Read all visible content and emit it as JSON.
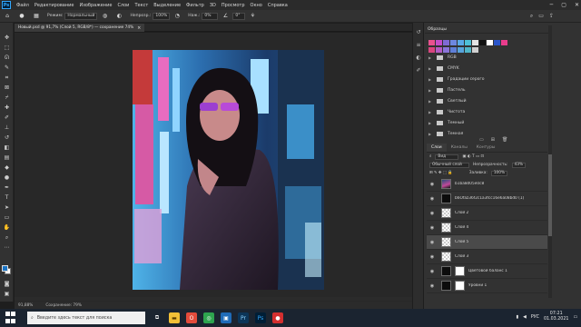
{
  "menu": {
    "logo": "Ps",
    "items": [
      "Файл",
      "Редактирование",
      "Изображение",
      "Слои",
      "Текст",
      "Выделение",
      "Фильтр",
      "3D",
      "Просмотр",
      "Окно",
      "Справка"
    ]
  },
  "options": {
    "mode_label": "Режим:",
    "mode_value": "Нормальный",
    "opacity_label": "Непрозр.:",
    "opacity_value": "100%",
    "flow_label": "Наж.:",
    "flow_value": "0%",
    "angle_value": "0°"
  },
  "document": {
    "tab_title": "Новый.psd @ 91,7% (Слой 5, RGB/8*) — сохранение 74%",
    "zoom": "91,88%",
    "status": "Сохранение: 79%"
  },
  "swatches": {
    "panel_title": "Образцы",
    "row1": [
      "#e8518f",
      "#c34dc9",
      "#7f6ad4",
      "#6d88e0",
      "#59a9e6",
      "#4dc0d6",
      "#e4e4e4",
      "#111111",
      "#ffffff",
      "#2a55c9",
      "#ea3c8c"
    ],
    "row2": [
      "#d9457f",
      "#b45bc4",
      "#8a74d9",
      "#5f7fd8",
      "#58a4dc",
      "#50b6c8",
      "#d0d0d0"
    ],
    "folders": [
      "RGB",
      "CMYK",
      "Градации серого",
      "Пастель",
      "Светлый",
      "Чистота",
      "Темный",
      "Темная"
    ]
  },
  "layers": {
    "tabs": [
      "Слои",
      "Каналы",
      "Контуры"
    ],
    "kind_label": "Вид",
    "blend_value": "Обычный слой",
    "opacity_label": "Непрозрачность:",
    "opacity_value": "43%",
    "fill_label": "Заливка:",
    "fill_value": "100%",
    "items": [
      {
        "name": "b1ba8d05e0c8",
        "thumb": "photo"
      },
      {
        "name": "b6Ofaz36f2c1a3fcc16e6a08bd0 (1)",
        "thumb": "dark"
      },
      {
        "name": "Слой 2",
        "thumb": "check"
      },
      {
        "name": "Слой 4",
        "thumb": "check"
      },
      {
        "name": "Слой 5",
        "thumb": "check"
      },
      {
        "name": "Слой 3",
        "thumb": "check"
      },
      {
        "name": "Цветовой баланс 1",
        "thumb": "dark"
      },
      {
        "name": "Уровни 1",
        "thumb": "dark"
      }
    ]
  },
  "taskbar": {
    "search_placeholder": "Введите здесь текст для поиска",
    "lang": "РУС",
    "time": "07:21",
    "date": "01.03.2021"
  }
}
